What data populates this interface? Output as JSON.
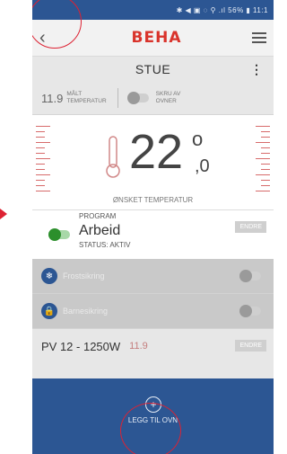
{
  "statusbar": {
    "text": "✱ ◀ ▣ ◌ ⚲ .ıl 56% ▮ 11:1"
  },
  "appbar": {
    "brand": "BEHA"
  },
  "room": {
    "name": "STUE",
    "measured_value": "11.9",
    "measured_label_1": "MÅLT",
    "measured_label_2": "TEMPERATUR",
    "heater_label_1": "SKRU AV",
    "heater_label_2": "OVNER"
  },
  "setpoint": {
    "integer": "22",
    "decimal": ",0",
    "degree": "o",
    "caption": "ØNSKET TEMPERATUR"
  },
  "program": {
    "label": "PROGRAM",
    "value": "Arbeid",
    "status": "STATUS: AKTIV",
    "edit_label": "ENDRE"
  },
  "list": [
    {
      "label": "Frostsikring",
      "icon": "snowflake-icon"
    },
    {
      "label": "Barnesikring",
      "icon": "lock-icon"
    }
  ],
  "device": {
    "name": "PV 12 - 1250W",
    "temp": "11.9",
    "edit_label": "ENDRE"
  },
  "footer": {
    "add_label": "LEGG TIL OVN"
  },
  "colors": {
    "primary": "#2c5693",
    "brand": "#d9332b",
    "toggle_on": "#2c8f2c"
  }
}
